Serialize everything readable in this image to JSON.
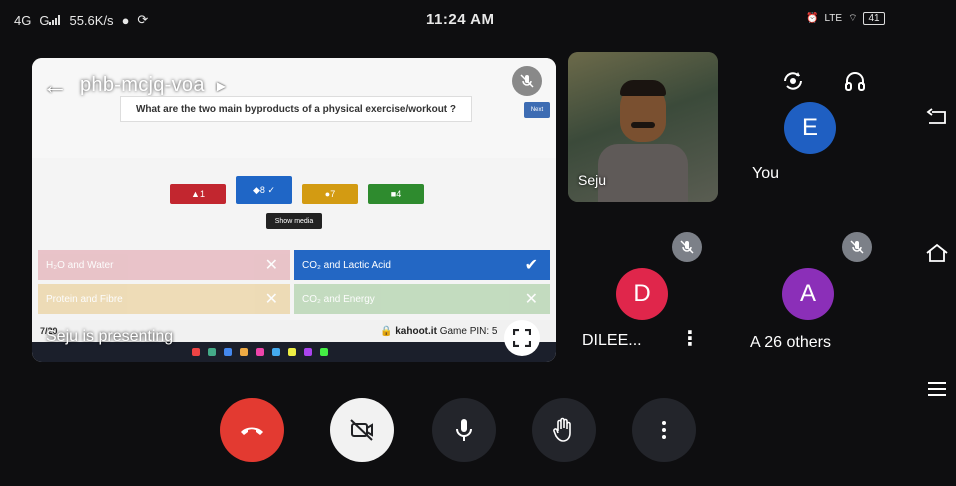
{
  "status_bar": {
    "network_1": "4G",
    "network_2": "G",
    "speed": "55.6K/s",
    "time": "11:24 AM",
    "lte": "LTE",
    "battery": "41"
  },
  "presentation": {
    "meeting_code": "phb-mcjq-voa",
    "question": "What are the two main byproducts of a physical exercise/workout ?",
    "show_media_label": "Show media",
    "chips": [
      {
        "label": "▲1"
      },
      {
        "label": "◆8 ✓"
      },
      {
        "label": "●7"
      },
      {
        "label": "■4"
      }
    ],
    "answers": [
      {
        "text": "H₂O and Water"
      },
      {
        "text": "CO₂ and Lactic Acid"
      },
      {
        "text": "Protein and Fibre"
      },
      {
        "text": "CO₂ and Energy"
      }
    ],
    "question_count": "7/20",
    "kahoot_label": "kahoot.it",
    "game_pin_label": "Game PIN: 5",
    "presenting_label": "Seju is presenting"
  },
  "participants": {
    "seju": {
      "name": "Seju"
    },
    "you": {
      "initial": "E",
      "name": "You",
      "color": "#1f5fc2"
    },
    "dilee": {
      "initial": "D",
      "name": "DILEE...",
      "color": "#e0264b"
    },
    "others": {
      "initial": "A",
      "prefix": "A",
      "name": "26 others",
      "color": "#8b2fb8"
    }
  },
  "icons": {
    "back": "arrow-left-icon",
    "flip_camera": "flip-camera-icon",
    "audio": "headphones-icon",
    "fullscreen": "fullscreen-icon",
    "end_call": "phone-hangup-icon",
    "camera_off": "video-off-icon",
    "mic": "mic-icon",
    "hand": "raise-hand-icon",
    "more": "more-vertical-icon"
  }
}
